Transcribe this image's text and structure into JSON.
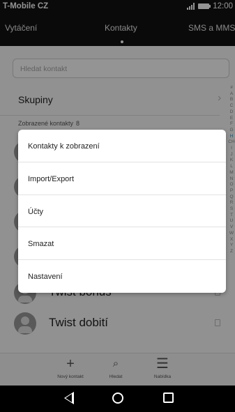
{
  "status_bar": {
    "carrier": "T-Mobile CZ",
    "time": "12:00"
  },
  "tabs": [
    {
      "label": "Vytáčení"
    },
    {
      "label": "Kontakty",
      "active": true
    },
    {
      "label": "SMS a MMS"
    }
  ],
  "search": {
    "placeholder": "Hledat kontakt"
  },
  "groups": {
    "label": "Skupiny"
  },
  "shown_contacts": {
    "label": "Zobrazené kontakty",
    "count": "8"
  },
  "contacts": [
    {
      "name": "Twist bonus"
    },
    {
      "name": "Twist dobití"
    }
  ],
  "alphabet": [
    "#",
    "A",
    "B",
    "C",
    "D",
    "E",
    "F",
    "G",
    "H",
    "CH",
    "I",
    "J",
    "K",
    "L",
    "M",
    "N",
    "O",
    "P",
    "Q",
    "R",
    "S",
    "T",
    "U",
    "V",
    "W",
    "X",
    "Y",
    "Z"
  ],
  "bottom_bar": [
    {
      "icon": "plus-icon",
      "label": "Nový kontakt"
    },
    {
      "icon": "search-icon",
      "label": "Hledat"
    },
    {
      "icon": "menu-icon",
      "label": "Nabídka"
    }
  ],
  "menu": [
    {
      "label": "Kontakty k zobrazení"
    },
    {
      "label": "Import/Export"
    },
    {
      "label": "Účty"
    },
    {
      "label": "Smazat"
    },
    {
      "label": "Nastavení"
    }
  ],
  "colors": {
    "dim": "#000000",
    "menu_bg": "#ffffff",
    "status_bg": "#121212"
  }
}
